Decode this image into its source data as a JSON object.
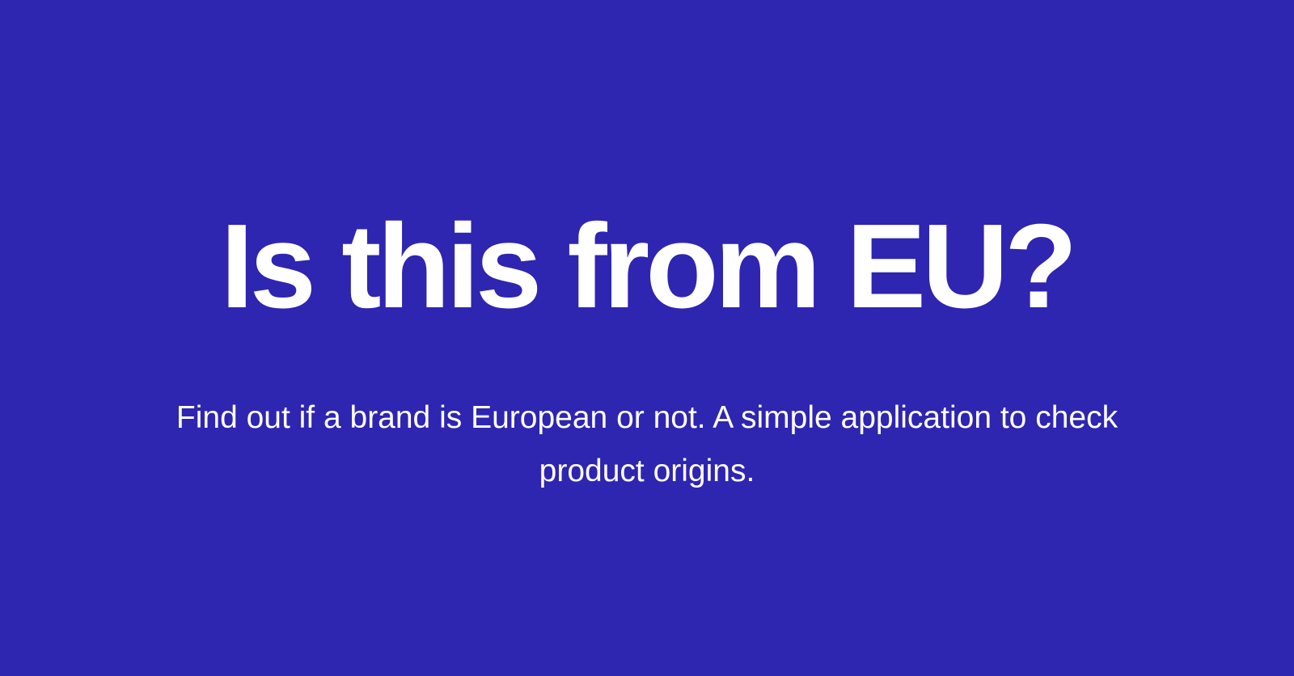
{
  "hero": {
    "title": "Is this from EU?",
    "subtitle": "Find out if a brand is European or not. A simple application to check product origins."
  },
  "theme": {
    "background": "#2e25b1",
    "text": "#ffffff"
  }
}
